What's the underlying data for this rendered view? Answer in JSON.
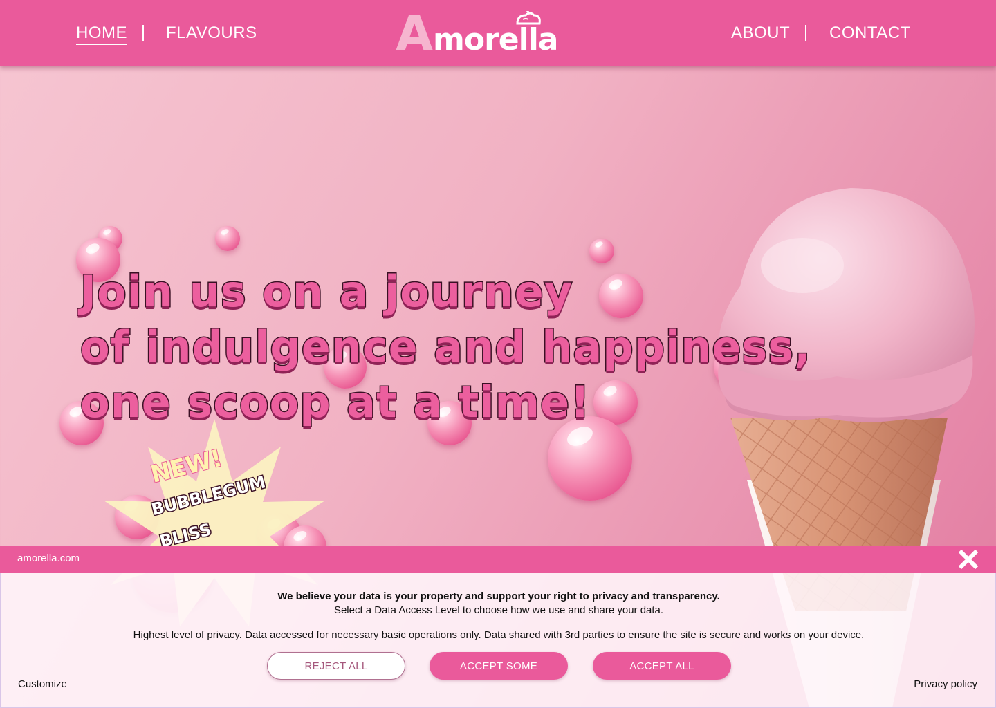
{
  "header": {
    "nav_left": [
      {
        "label": "HOME",
        "active": true
      },
      {
        "label": "FLAVOURS",
        "active": false
      }
    ],
    "nav_right": [
      {
        "label": "ABOUT"
      },
      {
        "label": "CONTACT"
      }
    ],
    "logo": {
      "initial": "A",
      "rest": "morella"
    }
  },
  "hero": {
    "headline_lines": [
      "Join us on a journey",
      "of indulgence and happiness,",
      "one scoop at a time!"
    ],
    "badge": {
      "tag": "NEW!",
      "name_line1": "BUBBLEGUM",
      "name_line2": "BLISS"
    }
  },
  "cookie": {
    "domain": "amorella.com",
    "title": "We believe your data is your property and support your right to privacy and transparency.",
    "subtitle": "Select a Data Access Level to choose how we use and share your data.",
    "description": "Highest level of privacy. Data accessed for necessary basic operations only. Data shared with 3rd parties to ensure the site is secure and works on your device.",
    "buttons": {
      "reject": "REJECT ALL",
      "some": "ACCEPT SOME",
      "all": "ACCEPT ALL"
    },
    "customize": "Customize",
    "privacy_policy": "Privacy policy"
  },
  "colors": {
    "brand_pink": "#ea5a9b",
    "hero_bg_light": "#f6c6d2",
    "hero_bg_dark": "#e27aa0",
    "headline_fill": "#ec5f9e",
    "headline_outline": "#3a1024",
    "badge_yellow": "#fff3b0"
  },
  "icons": {
    "close": "close-x-icon",
    "logo_cup": "ice-cream-cup-icon"
  }
}
